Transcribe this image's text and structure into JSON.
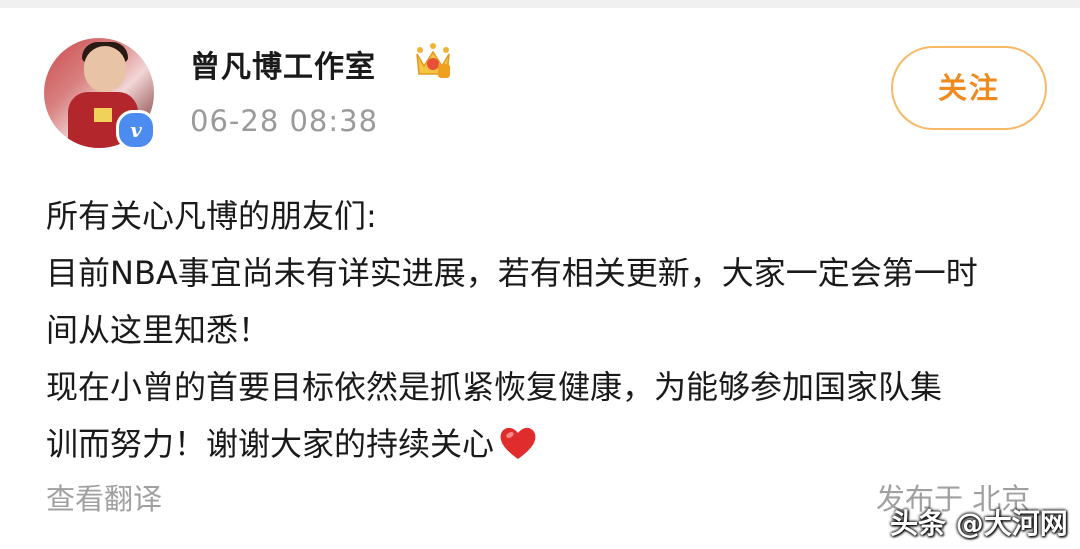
{
  "post": {
    "author": {
      "name": "曾凡博工作室",
      "verified_badge_icon": "verified-v-icon",
      "membership_icon": "crown-icon"
    },
    "timestamp": "06-28 08:38",
    "follow_label": "关注",
    "body_lines": [
      "所有关心凡博的朋友们:",
      "目前NBA事宜尚未有详实进展，若有相关更新，大家一定会第一时",
      "间从这里知悉！",
      "现在小曾的首要目标依然是抓紧恢复健康，为能够参加国家队集",
      "训而努力！谢谢大家的持续关心"
    ],
    "emoji_icon": "red-heart-icon",
    "translate_label": "查看翻译",
    "location_label": "发布于 北京"
  },
  "watermark": "头条 @大河网",
  "colors": {
    "accent_orange": "#f08a1e",
    "button_border": "#f7b867",
    "verified_blue": "#4c8cf0",
    "heart_red": "#e02c2c",
    "muted_gray": "#9a9a9a"
  }
}
